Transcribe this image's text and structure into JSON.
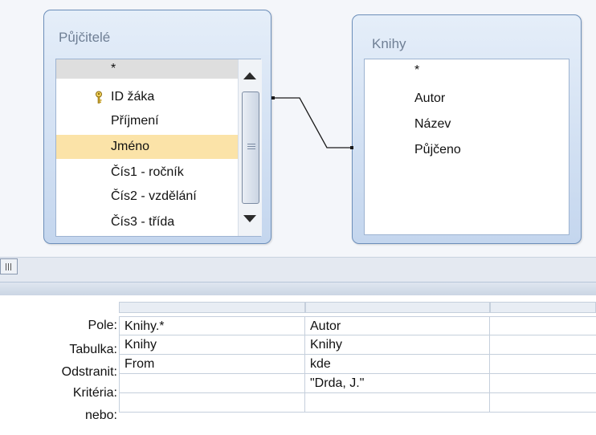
{
  "tables": [
    {
      "title": "Půjčitelé",
      "fields": [
        {
          "label": "*",
          "primary_key": false,
          "selected": false
        },
        {
          "label": "ID žáka",
          "primary_key": true,
          "selected": false
        },
        {
          "label": "Příjmení",
          "primary_key": false,
          "selected": false
        },
        {
          "label": "Jméno",
          "primary_key": false,
          "selected": true
        },
        {
          "label": "Čís1 - ročník",
          "primary_key": false,
          "selected": false
        },
        {
          "label": "Čís2 - vzdělání",
          "primary_key": false,
          "selected": false
        },
        {
          "label": "Čís3 - třída",
          "primary_key": false,
          "selected": false
        }
      ]
    },
    {
      "title": "Knihy",
      "fields": [
        {
          "label": "*"
        },
        {
          "label": "Autor"
        },
        {
          "label": "Název"
        },
        {
          "label": "Půjčeno"
        }
      ]
    }
  ],
  "grid": {
    "row_labels": [
      "Pole:",
      "Tabulka:",
      "Odstranit:",
      "Kritéria:",
      "nebo:"
    ],
    "columns": [
      {
        "values": [
          "Knihy.*",
          "Knihy",
          "From",
          "",
          ""
        ]
      },
      {
        "values": [
          "Autor",
          "Knihy",
          "kde",
          "\"Drda, J.\"",
          ""
        ]
      },
      {
        "values": [
          "",
          "",
          "",
          "",
          ""
        ]
      }
    ]
  },
  "colors": {
    "selected_field": "#fbe3a8",
    "window_border": "#6d8fba",
    "window_title_text": "#6f7f95"
  }
}
